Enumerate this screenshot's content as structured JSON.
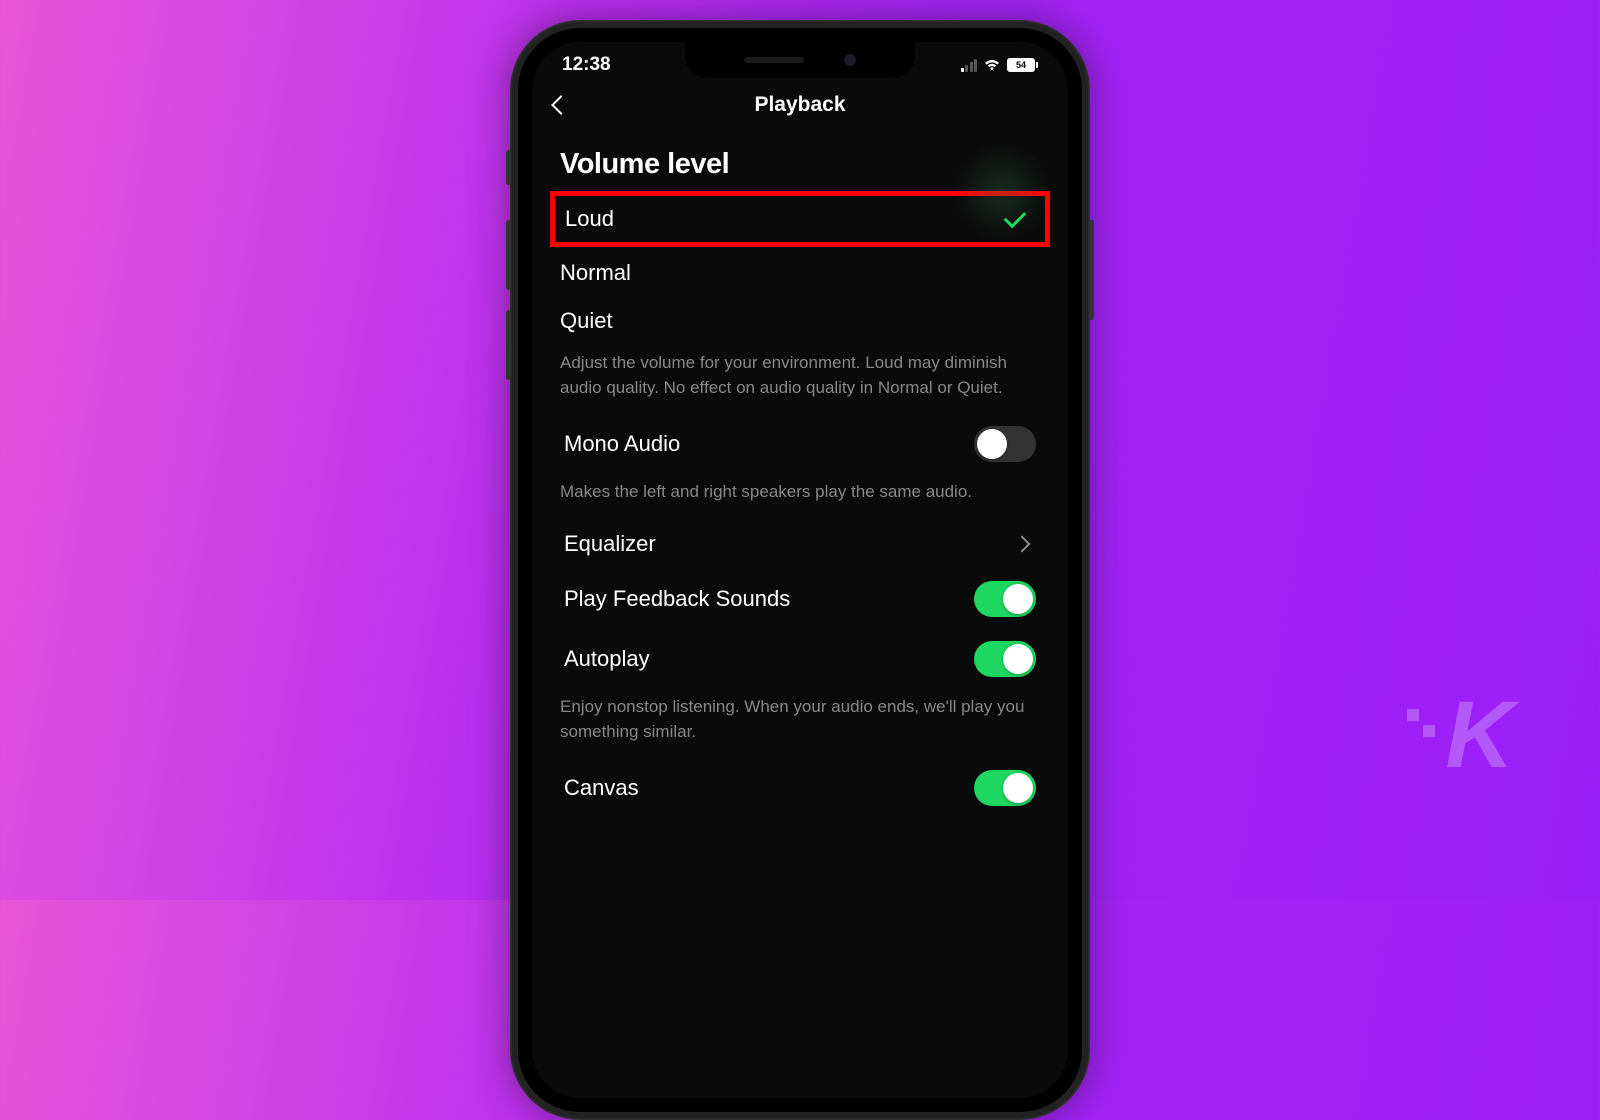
{
  "statusBar": {
    "time": "12:38",
    "battery": "54"
  },
  "nav": {
    "title": "Playback"
  },
  "volumeSection": {
    "title": "Volume level",
    "options": {
      "loud": "Loud",
      "normal": "Normal",
      "quiet": "Quiet"
    },
    "description": "Adjust the volume for your environment. Loud may diminish audio quality. No effect on audio quality in Normal or Quiet."
  },
  "settings": {
    "monoAudio": {
      "label": "Mono Audio",
      "description": "Makes the left and right speakers play the same audio.",
      "on": false
    },
    "equalizer": {
      "label": "Equalizer"
    },
    "playFeedback": {
      "label": "Play Feedback Sounds",
      "on": true
    },
    "autoplay": {
      "label": "Autoplay",
      "description": "Enjoy nonstop listening. When your audio ends, we'll play you something similar.",
      "on": true
    },
    "canvas": {
      "label": "Canvas",
      "on": true
    }
  },
  "watermark": "K"
}
